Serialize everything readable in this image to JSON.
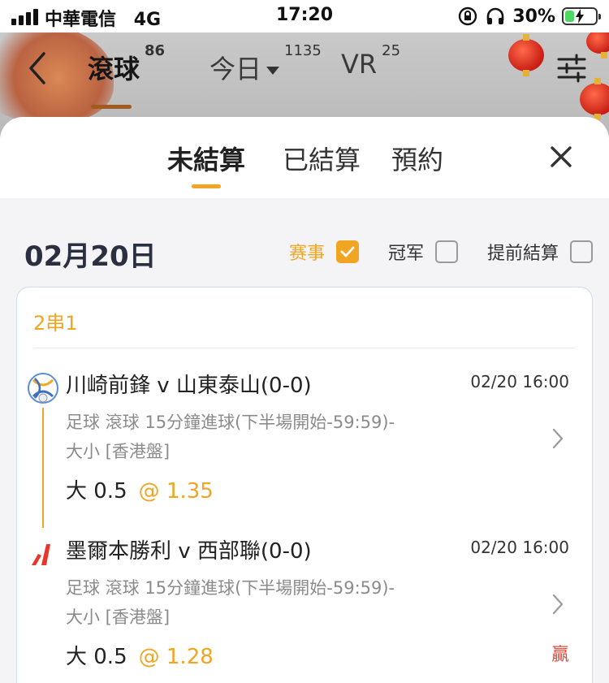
{
  "status_bar": {
    "carrier": "中華電信",
    "network": "4G",
    "time": "17:20",
    "battery": "30%",
    "battery_level": 0.3,
    "icons": [
      "signal-bars-icon",
      "orientation-lock-icon",
      "headphones-icon",
      "battery-charging-icon"
    ]
  },
  "header": {
    "back_icon": "chevron-left-icon",
    "tabs": [
      {
        "label": "滾球",
        "count": "86",
        "active": true
      },
      {
        "label": "今日",
        "count": "1135",
        "dropdown": true
      },
      {
        "label": "VR",
        "count": "25"
      }
    ],
    "filter_icon": "sliders-icon"
  },
  "sheet": {
    "tabs": [
      {
        "label": "未結算",
        "active": true
      },
      {
        "label": "已結算"
      },
      {
        "label": "預約"
      }
    ],
    "close_icon": "close-icon"
  },
  "date": "02月20日",
  "filters": [
    {
      "label": "赛事",
      "checked": true
    },
    {
      "label": "冠军",
      "checked": false
    },
    {
      "label": "提前結算",
      "checked": false
    }
  ],
  "bet": {
    "type": "2串1",
    "legs": [
      {
        "match": "川崎前鋒 v 山東泰山(0-0)",
        "time": "02/20 16:00",
        "desc": "足球  滾球   15分鐘進球(下半場開始-59:59)-大小 [香港盤]",
        "pick": "大 0.5",
        "odds": "@ 1.35",
        "result": "",
        "icon": "afc-champions-league-icon"
      },
      {
        "match": "墨爾本勝利 v 西部聯(0-0)",
        "time": "02/20 16:00",
        "desc": "足球  滾球   15分鐘進球(下半場開始-59:59)-大小 [香港盤]",
        "pick": "大 0.5",
        "odds": "@ 1.28",
        "result": "贏",
        "icon": "a-league-icon"
      }
    ]
  },
  "colors": {
    "accent": "#f0a523",
    "win": "#e64a3a",
    "card_border": "#cfdbee"
  }
}
